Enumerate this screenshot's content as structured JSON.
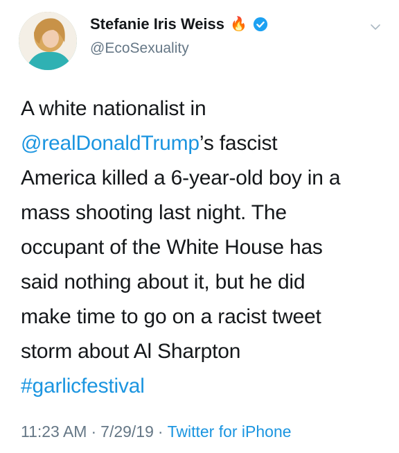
{
  "author": {
    "display_name": "Stefanie Iris Weiss",
    "emoji": "🔥",
    "handle": "@EcoSexuality",
    "verified": true
  },
  "tweet": {
    "line1": "A white nationalist in",
    "mention": "@realDonaldTrump",
    "line2_rest": "’s fascist",
    "body": "America killed a 6-year-old boy in a\nmass shooting last night. The\noccupant of the White House has\nsaid nothing about it, but he did\nmake time to go on a racist tweet\nstorm about Al Sharpton",
    "hashtag": "#garlicfestival"
  },
  "meta": {
    "time": "11:23 AM",
    "sep1": "·",
    "date": "7/29/19",
    "sep2": "·",
    "source": "Twitter for iPhone"
  },
  "colors": {
    "link": "#1b95e0",
    "muted": "#657786",
    "text": "#14171a",
    "verified": "#1da1f2"
  }
}
